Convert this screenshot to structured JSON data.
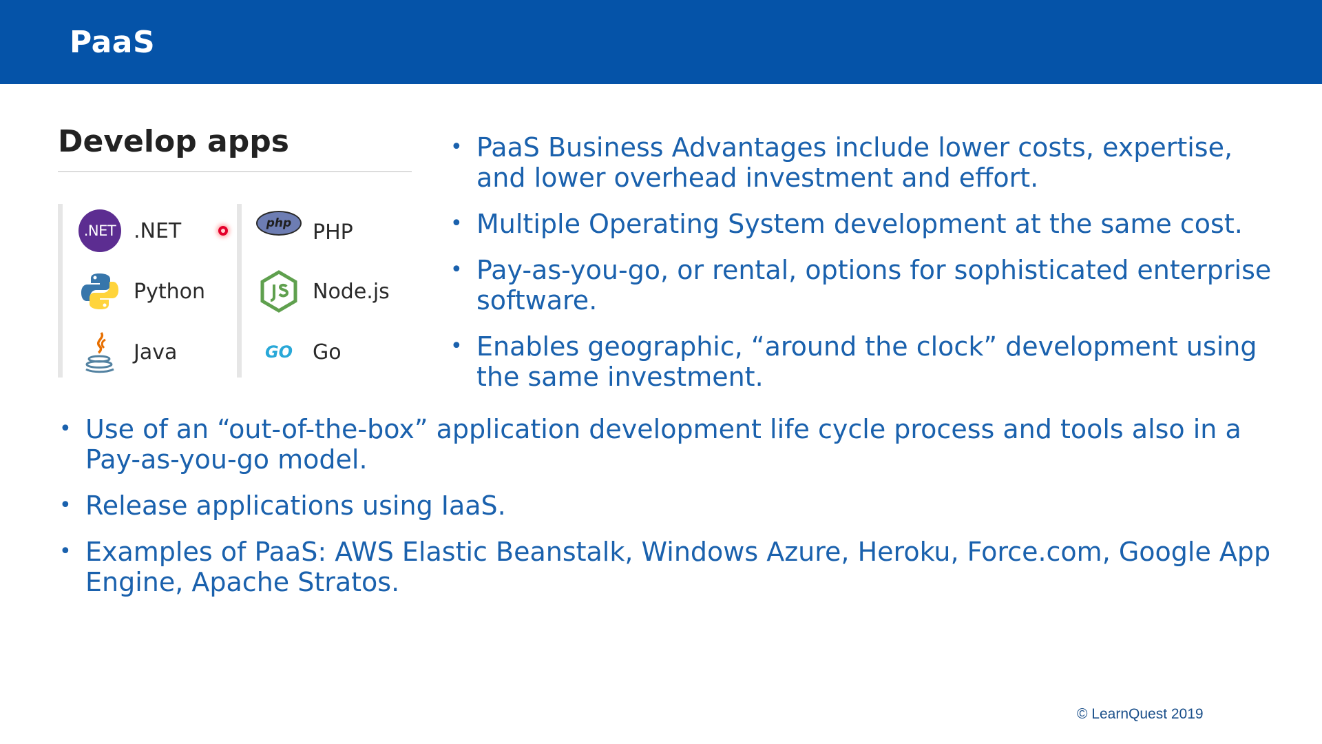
{
  "header": {
    "title": "PaaS"
  },
  "panel": {
    "title": "Develop apps",
    "languages": [
      {
        "label": ".NET",
        "icon": "dotnet-icon",
        "badge_text": ".NET"
      },
      {
        "label": "PHP",
        "icon": "php-icon",
        "badge_text": "php"
      },
      {
        "label": "Python",
        "icon": "python-icon"
      },
      {
        "label": "Node.js",
        "icon": "nodejs-icon"
      },
      {
        "label": "Java",
        "icon": "java-icon"
      },
      {
        "label": "Go",
        "icon": "go-icon",
        "badge_text": "GO"
      }
    ]
  },
  "right_bullets": [
    "PaaS Business Advantages include lower costs, expertise, and lower overhead investment and effort.",
    "Multiple Operating System development at the same cost.",
    "Pay-as-you-go, or rental, options for sophisticated enterprise software.",
    "Enables geographic, “around the clock” development using the same investment."
  ],
  "bottom_bullets": [
    "Use of an “out-of-the-box” application development life cycle process and tools also in a Pay-as-you-go model.",
    "Release applications using IaaS.",
    "Examples of PaaS: AWS Elastic Beanstalk, Windows Azure, Heroku, Force.com, Google App Engine, Apache Stratos."
  ],
  "footer": {
    "copyright": "© LearnQuest 2019"
  },
  "colors": {
    "banner": "#0553a8",
    "bullet_text": "#1a61ad",
    "pointer": "#e4002b"
  }
}
